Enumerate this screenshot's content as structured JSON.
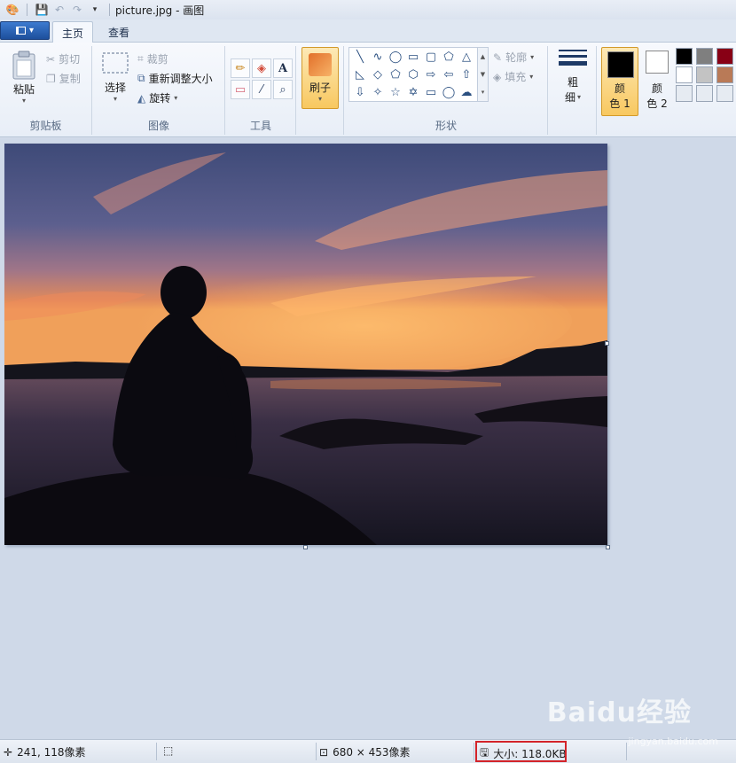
{
  "titlebar": {
    "title": "picture.jpg - 画图"
  },
  "tabs": {
    "home": "主页",
    "view": "查看"
  },
  "clipboard": {
    "paste": "粘贴",
    "cut": "剪切",
    "copy": "复制",
    "label": "剪贴板"
  },
  "image": {
    "select": "选择",
    "crop": "裁剪",
    "resize": "重新调整大小",
    "rotate": "旋转",
    "label": "图像"
  },
  "tools": {
    "label": "工具",
    "text_glyph": "A"
  },
  "brushes": {
    "label": "刷子"
  },
  "shapes": {
    "label": "形状",
    "outline": "轮廓",
    "fill": "填充"
  },
  "size": {
    "label_top": "粗",
    "label_bottom": "细"
  },
  "colors": {
    "color1_top": "颜",
    "color1_bottom": "色 1",
    "color2_top": "颜",
    "color2_bottom": "色 2",
    "color1_value": "#000000",
    "color2_value": "#ffffff",
    "palette": [
      "#000000",
      "#7f7f7f",
      "#880015",
      "#ffffff",
      "#c3c3c3",
      "#b97a57",
      "#e6ebf2",
      "#e6ebf2",
      "#e6ebf2"
    ]
  },
  "statusbar": {
    "cursor_pos": "241, 118像素",
    "image_size": "680 × 453像素",
    "file_size": "大小: 118.0KB"
  },
  "watermark": {
    "brand": "Baidu经验",
    "url": "jingyan.baidu.com"
  }
}
